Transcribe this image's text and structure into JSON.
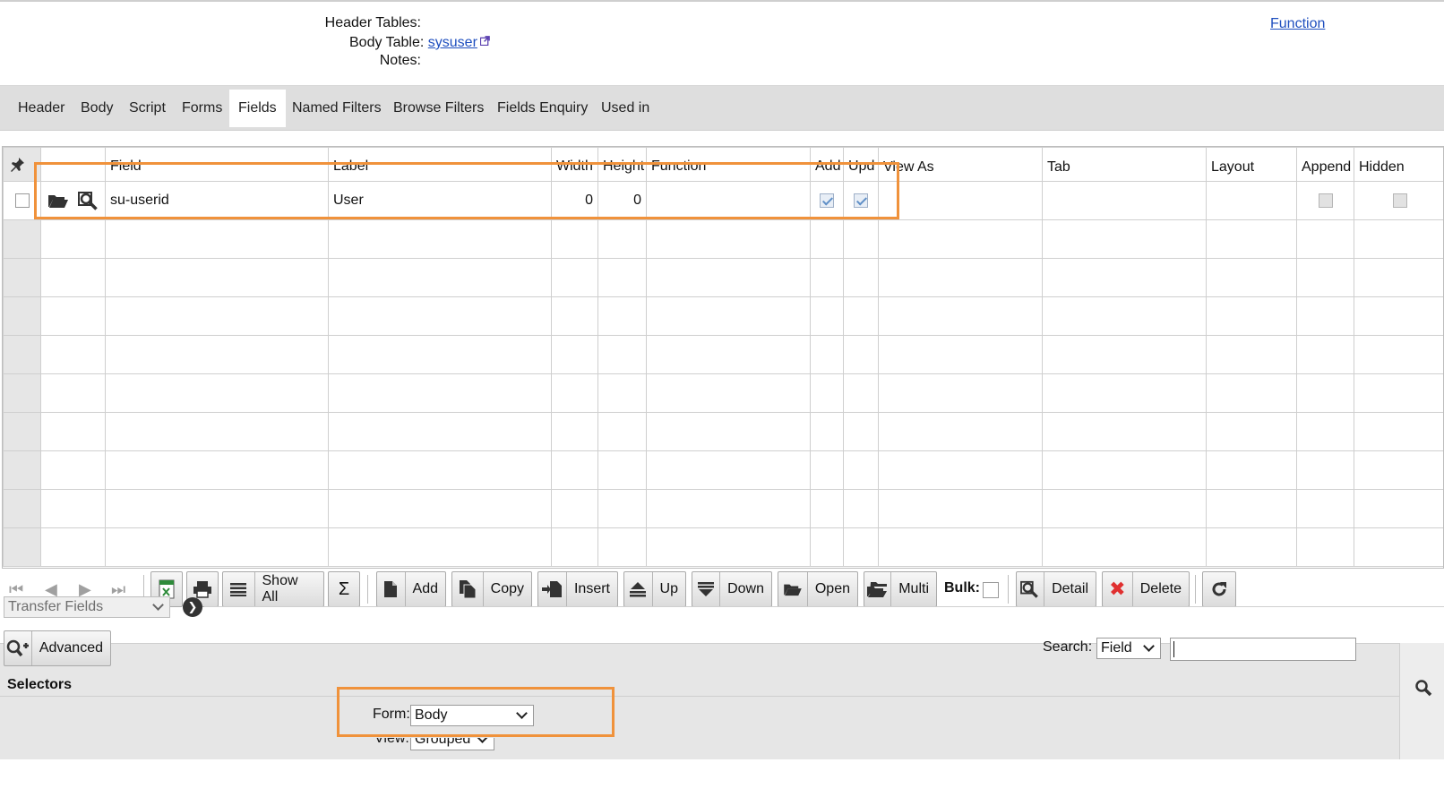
{
  "header": {
    "header_tables_label": "Header Tables:",
    "body_table_label": "Body Table:",
    "body_table_link": "sysuser",
    "notes_label": "Notes:",
    "function_link": "Function"
  },
  "tabs": [
    {
      "label": "Header"
    },
    {
      "label": "Body"
    },
    {
      "label": "Script"
    },
    {
      "label": "Forms"
    },
    {
      "label": "Fields",
      "active": true
    },
    {
      "label": "Named Filters"
    },
    {
      "label": "Browse Filters"
    },
    {
      "label": "Fields Enquiry"
    },
    {
      "label": "Used in"
    }
  ],
  "grid": {
    "columns": [
      "Field",
      "Label",
      "Width",
      "Height",
      "Function",
      "Add",
      "Upd",
      "View As",
      "Tab",
      "Layout",
      "Append",
      "Hidden"
    ],
    "rows": [
      {
        "field": "su-userid",
        "label": "User",
        "width": "0",
        "height": "0",
        "function": "",
        "add": true,
        "upd": true,
        "view_as": "",
        "tab": "",
        "layout": "",
        "append": false,
        "hidden": false
      }
    ]
  },
  "toolbar": {
    "show_all": "Show All",
    "add": "Add",
    "copy": "Copy",
    "insert": "Insert",
    "up": "Up",
    "down": "Down",
    "open": "Open",
    "multi": "Multi",
    "bulk": "Bulk:",
    "detail": "Detail",
    "delete": "Delete"
  },
  "transfer": {
    "selected": "Transfer Fields"
  },
  "filters": {
    "advanced": "Advanced",
    "search_label": "Search:",
    "search_field": "Field",
    "search_value": "",
    "selectors": "Selectors",
    "form_label": "Form:",
    "form_value": "Body",
    "view_label": "View:",
    "view_value": "Grouped"
  },
  "colors": {
    "highlight": "#f0923b",
    "link": "#1f4fbf",
    "delete": "#e03030"
  }
}
